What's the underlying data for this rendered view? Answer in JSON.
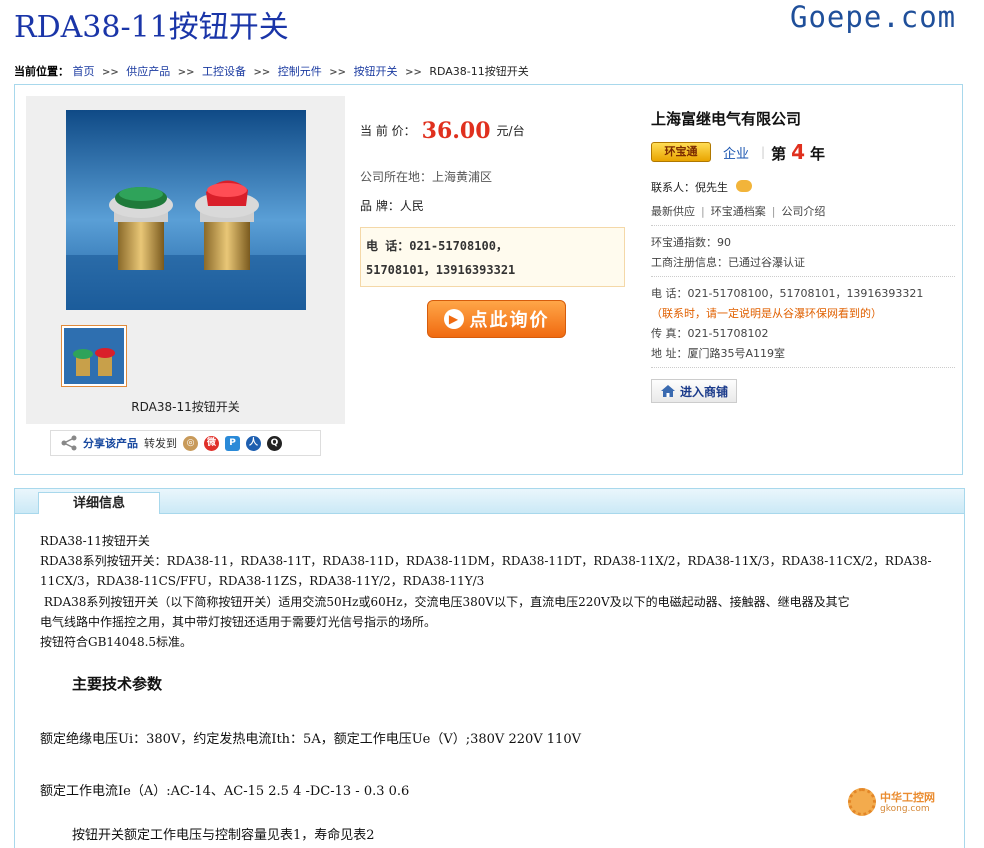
{
  "header": {
    "title": "RDA38-11按钮开关",
    "logo": "Goepe.com"
  },
  "breadcrumb": {
    "label": "当前位置：",
    "items": [
      "首页",
      "供应产品",
      "工控设备",
      "控制元件",
      "按钮开关"
    ],
    "sep": ">>",
    "current": "RDA38-11按钮开关"
  },
  "product": {
    "caption": "RDA38-11按钮开关",
    "price_label": "当  前  价：",
    "price": "36.00",
    "price_unit": "元/台",
    "location": "公司所在地：上海黄浦区",
    "brand": "品  牌：人民",
    "phone_line1": "电 话：021-51708100，",
    "phone_line2": "51708101，13916393321",
    "inquiry_label": "点此询价"
  },
  "share": {
    "label": "分享该产品",
    "forward": "转发到"
  },
  "company": {
    "name": "上海富继电气有限公司",
    "badge": "环宝通",
    "type": "企业",
    "year_prefix": "第",
    "year_num": "4",
    "year_suffix": "年",
    "contact": "联系人：倪先生",
    "links": [
      "最新供应",
      "环宝通档案",
      "公司介绍"
    ],
    "index": "环宝通指数：90",
    "registration": "工商注册信息：已通过谷瀑认证",
    "phone": "电  话：021-51708100，51708101，13916393321",
    "notice": "（联系时，请一定说明是从谷瀑环保网看到的）",
    "fax": "传  真：021-51708102",
    "address": "地  址：厦门路35号A119室",
    "shop_btn": "进入商铺"
  },
  "detail": {
    "tab": "详细信息",
    "lines": [
      "RDA38-11按钮开关",
      "RDA38系列按钮开关：RDA38-11，RDA38-11T，RDA38-11D，RDA38-11DM，RDA38-11DT，RDA38-11X/2，RDA38-11X/3，RDA38-11CX/2，RDA38-",
      "11CX/3，RDA38-11CS/FFU，RDA38-11ZS，RDA38-11Y/2，RDA38-11Y/3",
      " RDA38系列按钮开关（以下简称按钮开关）适用交流50Hz或60Hz，交流电压380V以下，直流电压220V及以下的电磁起动器、接触器、继电器及其它",
      "电气线路中作摇控之用，其中带灯按钮还适用于需要灯光信号指示的场所。",
      "按钮符合GB14048.5标准。"
    ],
    "section_title": "主要技术参数",
    "param1": "额定绝缘电压Ui：380V，约定发热电流Ith：5A，额定工作电压Ue（V）;380V 220V 110V",
    "param2": "额定工作电流Ie（A）:AC-14、AC-15 2.5 4 -DC-13 - 0.3 0.6",
    "param3": "按钮开关额定工作电压与控制容量见表1，寿命见表2"
  },
  "watermark": {
    "name": "中华工控网",
    "url": "gkong.com"
  }
}
